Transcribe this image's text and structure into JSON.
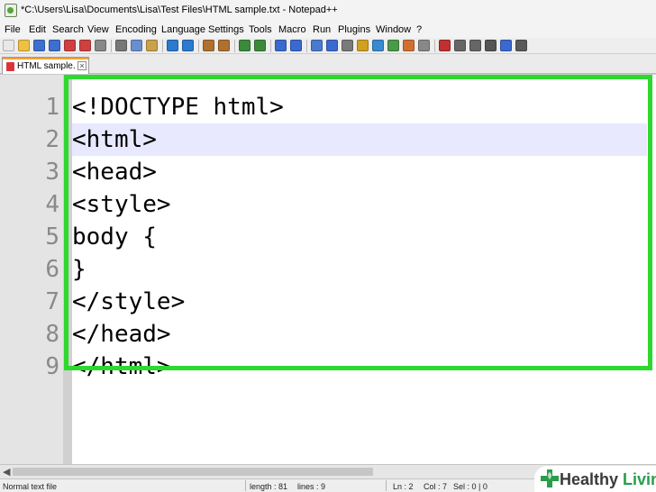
{
  "window": {
    "title": "*C:\\Users\\Lisa\\Documents\\Lisa\\Test Files\\HTML sample.txt - Notepad++"
  },
  "menu": [
    "File",
    "Edit",
    "Search",
    "View",
    "Encoding",
    "Language",
    "Settings",
    "Tools",
    "Macro",
    "Run",
    "Plugins",
    "Window",
    "?"
  ],
  "toolbar_icons": [
    "new-file-icon",
    "open-file-icon",
    "save-icon",
    "save-all-icon",
    "close-icon",
    "close-all-icon",
    "print-icon",
    "cut-icon",
    "copy-icon",
    "paste-icon",
    "undo-icon",
    "redo-icon",
    "find-icon",
    "replace-icon",
    "zoom-in-icon",
    "zoom-out-icon",
    "sync-vertical-icon",
    "sync-horizontal-icon",
    "word-wrap-icon",
    "show-all-chars-icon",
    "indent-guide-icon",
    "user-language-icon",
    "doc-map-icon",
    "function-list-icon",
    "folder-workspace-icon",
    "monitoring-icon",
    "record-macro-icon",
    "stop-macro-icon",
    "play-macro-icon",
    "run-macro-multiple-icon",
    "save-macro-icon",
    "spell-check-icon"
  ],
  "tab": {
    "label": "HTML sample.txt"
  },
  "editor": {
    "current_line": 2,
    "lines": [
      {
        "num": "1",
        "text": "<!DOCTYPE html>"
      },
      {
        "num": "2",
        "text": "<html>"
      },
      {
        "num": "3",
        "text": "<head>"
      },
      {
        "num": "4",
        "text": "<style>"
      },
      {
        "num": "5",
        "text": "body {"
      },
      {
        "num": "6",
        "text": "}"
      },
      {
        "num": "7",
        "text": "</style>"
      },
      {
        "num": "8",
        "text": "</head>"
      },
      {
        "num": "9",
        "text": "</html>"
      }
    ]
  },
  "status": {
    "file_type": "Normal text file",
    "length": "length : 81",
    "lines": "lines : 9",
    "ln": "Ln : 2",
    "col": "Col : 7",
    "sel": "Sel : 0 | 0"
  },
  "watermark": {
    "text_part1": "Healthy",
    "text_part2": "Living"
  },
  "colors": {
    "highlight": "#2ed82e",
    "current_line": "#e8e8ff",
    "watermark_green": "#2a9d4b"
  }
}
